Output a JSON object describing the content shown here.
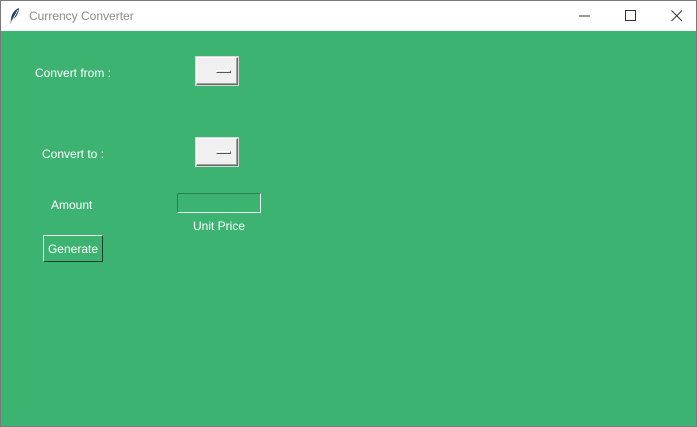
{
  "window": {
    "title": "Currency Converter",
    "icon": "feather-icon",
    "controls": [
      "minimize-icon",
      "maximize-icon",
      "close-icon"
    ]
  },
  "form": {
    "convert_from_label": "Convert from :",
    "convert_to_label": "Convert to :",
    "amount_label": "Amount",
    "amount_value": "",
    "unit_price_label": "Unit Price",
    "generate_label": "Generate"
  },
  "colors": {
    "background": "#3cb371",
    "text": "#ffffff",
    "titlebar": "#ffffff"
  }
}
